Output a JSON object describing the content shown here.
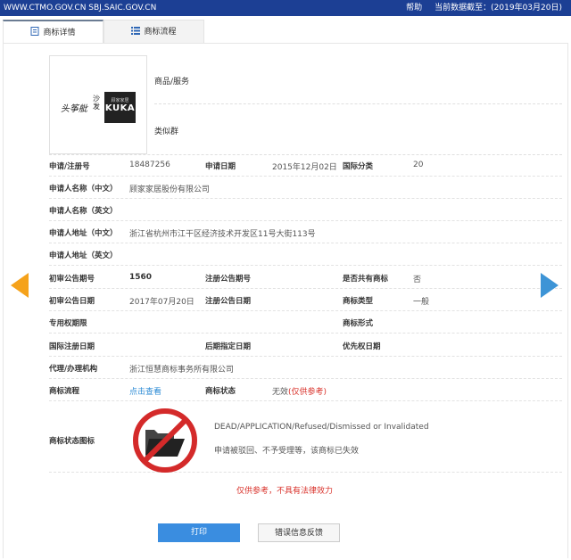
{
  "topbar": {
    "site": "WWW.CTMO.GOV.CN SBJ.SAIC.GOV.CN",
    "help": "帮助",
    "data_date": "当前数据截至：(2019年03月20日)",
    "color": "#1c3f94"
  },
  "tabs": [
    {
      "label": "商标详情",
      "icon": "document-icon",
      "active": true
    },
    {
      "label": "商标流程",
      "icon": "list-icon",
      "active": false
    }
  ],
  "logo": {
    "text_cn": "头筝舭",
    "text_sf": "沙发",
    "brand_small": "顾家家居",
    "brand": "KUKA"
  },
  "goods": {
    "goods_label": "商品/服务",
    "group_label": "类似群"
  },
  "rows": {
    "reg_no_label": "申请/注册号",
    "reg_no": "18487256",
    "app_date_label": "申请日期",
    "app_date": "2015年12月02日",
    "intl_class_label": "国际分类",
    "intl_class": "20",
    "name_cn_label": "申请人名称（中文）",
    "name_cn": "顾家家居股份有限公司",
    "name_en_label": "申请人名称（英文）",
    "addr_cn_label": "申请人地址（中文）",
    "addr_cn": "浙江省杭州市江干区经济技术开发区11号大街113号",
    "addr_en_label": "申请人地址（英文）",
    "prelim_no_label": "初审公告期号",
    "prelim_no": "1560",
    "reg_pub_no_label": "注册公告期号",
    "shared_label": "是否共有商标",
    "shared": "否",
    "prelim_date_label": "初审公告日期",
    "prelim_date": "2017年07月20日",
    "reg_pub_date_label": "注册公告日期",
    "type_label": "商标类型",
    "type": "一般",
    "term_label": "专用权期限",
    "form_label": "商标形式",
    "intl_reg_date_label": "国际注册日期",
    "later_date_label": "后期指定日期",
    "priority_label": "优先权日期",
    "agent_label": "代理/办理机构",
    "agent": "浙江恒慧商标事务所有限公司",
    "flow_label": "商标流程",
    "flow_link": "点击查看",
    "status_label": "商标状态",
    "status": "无效",
    "status_note": "(仅供参考)",
    "status_icon_label": "商标状态图标",
    "status_en": "DEAD/APPLICATION/Refused/Dismissed or Invalidated",
    "status_cn": "申请被驳回、不予受理等，该商标已失效"
  },
  "disclaimer": "仅供参考，不具有法律效力",
  "buttons": {
    "print": "打印",
    "feedback": "错误信息反馈"
  },
  "colors": {
    "accent": "#3a8de0",
    "prev_arrow": "#f5a21b",
    "next_arrow": "#3d94d6",
    "warning": "#d9322b"
  }
}
